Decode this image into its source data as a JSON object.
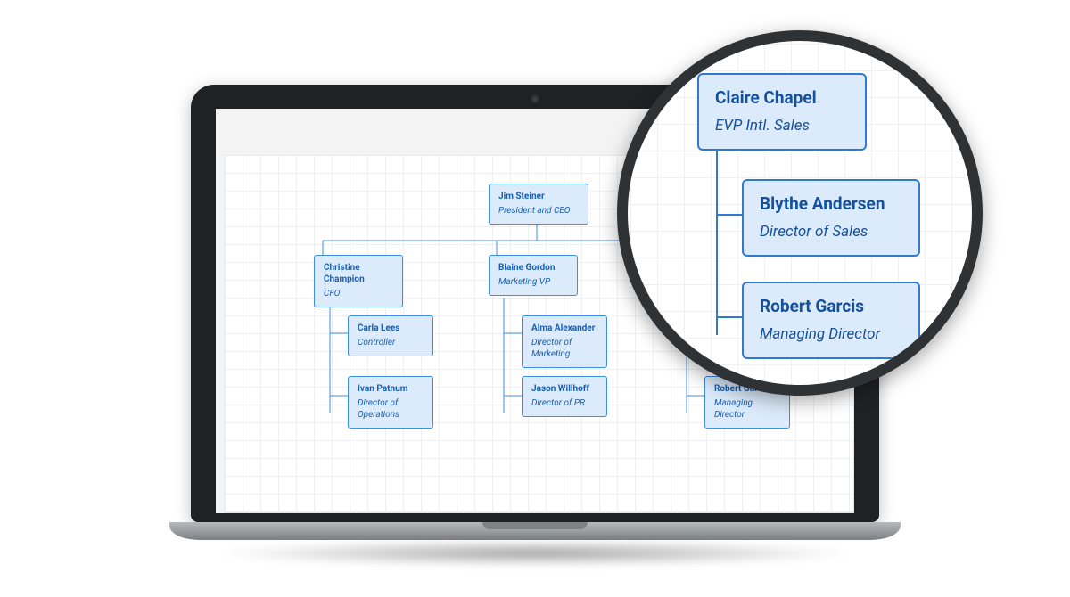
{
  "root": {
    "name": "Jim Steiner",
    "title": "President and CEO"
  },
  "col1": {
    "head": {
      "name": "Christine Champion",
      "title": "CFO"
    },
    "children": [
      {
        "name": "Carla Lees",
        "title": "Controller"
      },
      {
        "name": "Ivan Patnum",
        "title": "Director of Operations"
      }
    ]
  },
  "col2": {
    "head": {
      "name": "Blaine Gordon",
      "title": "Marketing VP"
    },
    "children": [
      {
        "name": "Alma Alexander",
        "title": "Director of Marketing"
      },
      {
        "name": "Jason Willhoff",
        "title": "Director of PR"
      }
    ]
  },
  "col3": {
    "head": {
      "name": "Claire Chapel",
      "title": "EVP Intl. Sales"
    },
    "children": [
      {
        "name": "Blythe Andersen",
        "title": "Director of Sales"
      },
      {
        "name": "Robert Garcis",
        "title": "Managing Director"
      }
    ]
  },
  "zoom": {
    "head": {
      "name": "Claire Chapel",
      "title": "EVP Intl. Sales"
    },
    "children": [
      {
        "name": "Blythe Andersen",
        "title": "Director of Sales"
      },
      {
        "name": "Robert Garcis",
        "title": "Managing Director"
      }
    ]
  }
}
